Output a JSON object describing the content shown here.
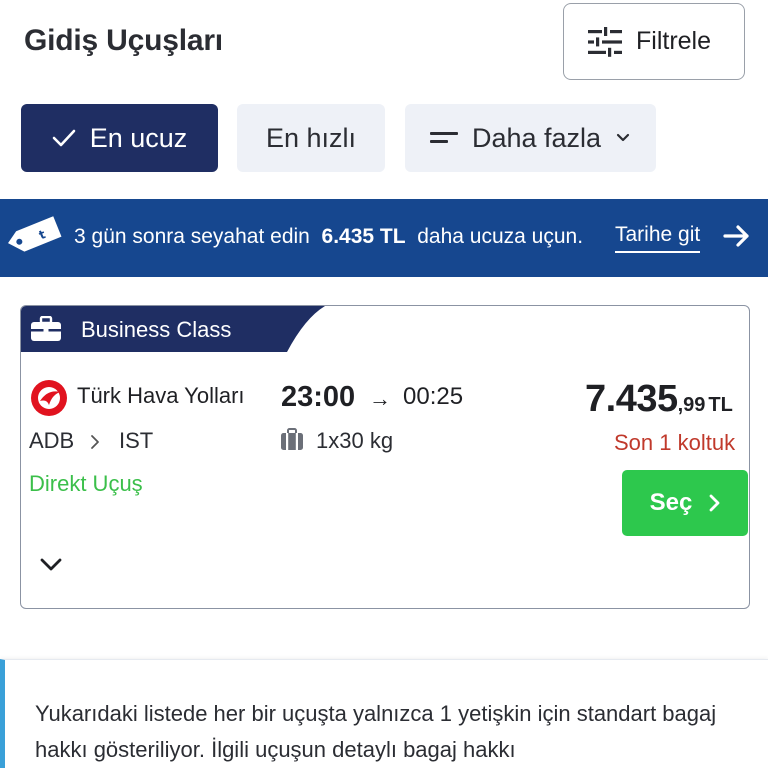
{
  "header": {
    "title": "Gidiş Uçuşları",
    "filter_label": "Filtrele"
  },
  "sort": {
    "cheapest_label": "En ucuz",
    "fastest_label": "En hızlı",
    "more_label": "Daha fazla",
    "selected": "En ucuz"
  },
  "promo": {
    "message_prefix": "3 gün sonra seyahat edin",
    "amount": "6.435 TL",
    "message_suffix": "daha ucuza uçun.",
    "link_label": "Tarihe git"
  },
  "flight": {
    "class_label": "Business Class",
    "airline": "Türk Hava Yolları",
    "departure_time": "23:00",
    "arrow": "→",
    "arrival_time": "00:25",
    "price_main": "7.435",
    "price_decimal": ",99",
    "currency": "TL",
    "from": "ADB",
    "to": "IST",
    "baggage": "1x30 kg",
    "seats_left": "Son 1 koltuk",
    "stops": "Direkt Uçuş",
    "select_label": "Seç"
  },
  "info": {
    "text": "Yukarıdaki listede her bir uçuşta yalnızca 1 yetişkin için standart bagaj hakkı gösteriliyor. İlgili uçuşun detaylı bagaj hakkı"
  },
  "colors": {
    "navy": "#1f2e63",
    "promo_blue": "#16478f",
    "green": "#2dc84d",
    "direct_green": "#3bbf4a",
    "warning_red": "#c0392b",
    "chip_bg": "#eef1f7",
    "info_accent": "#3aa0d8"
  },
  "icons": {
    "filter": "sliders-icon",
    "check": "check-icon",
    "sort_lines": "sort-lines-icon",
    "dropdown": "chevron-down-icon",
    "price_tag": "price-tag-icon",
    "forward": "arrow-right-icon",
    "briefcase": "briefcase-icon",
    "airline_logo": "turkish-airlines-logo",
    "baggage": "luggage-icon",
    "select_chevron": "chevron-right-icon",
    "expand": "chevron-down-icon"
  }
}
